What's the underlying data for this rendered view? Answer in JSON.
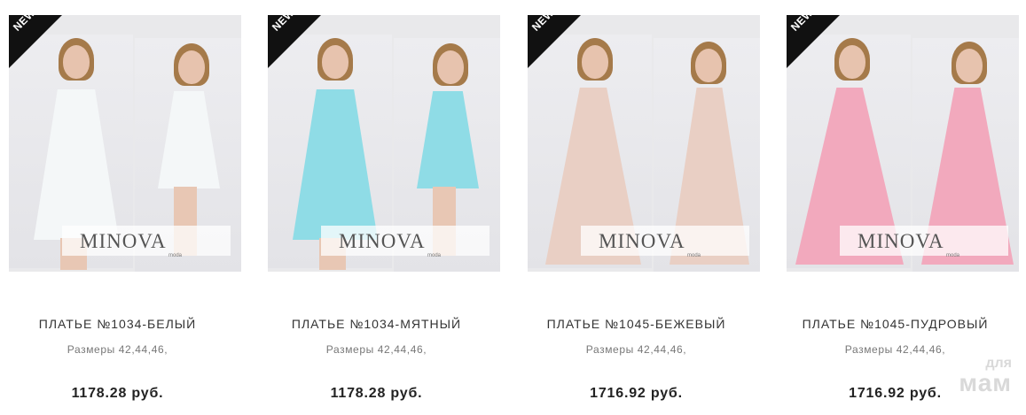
{
  "products": [
    {
      "badge": "NEW",
      "brand": "MINOVA",
      "brand_sub": "moda",
      "name": "ПЛАТЬЕ №1034-БЕЛЫЙ",
      "sizes": "Размеры 42,44,46,",
      "price": "1178.28 руб.",
      "dress_color": "#f4f7f8",
      "trim_color": "#444444"
    },
    {
      "badge": "NEW",
      "brand": "MINOVA",
      "brand_sub": "moda",
      "name": "ПЛАТЬЕ №1034-МЯТНЫЙ",
      "sizes": "Размеры 42,44,46,",
      "price": "1178.28 руб.",
      "dress_color": "#8fdce6",
      "trim_color": "#444444"
    },
    {
      "badge": "NEW",
      "brand": "MINOVA",
      "brand_sub": "moda",
      "name": "ПЛАТЬЕ №1045-БЕЖЕВЫЙ",
      "sizes": "Размеры 42,44,46,",
      "price": "1716.92 руб.",
      "dress_color": "#e9cfc4",
      "trim_color": "#e9cfc4"
    },
    {
      "badge": "NEW",
      "brand": "MINOVA",
      "brand_sub": "moda",
      "name": "ПЛАТЬЕ №1045-ПУДРОВЫЙ",
      "sizes": "Размеры 42,44,46,",
      "price": "1716.92 руб.",
      "dress_color": "#f2a9bd",
      "trim_color": "#f2a9bd"
    }
  ],
  "watermark": {
    "top": "для",
    "main": "мам"
  }
}
